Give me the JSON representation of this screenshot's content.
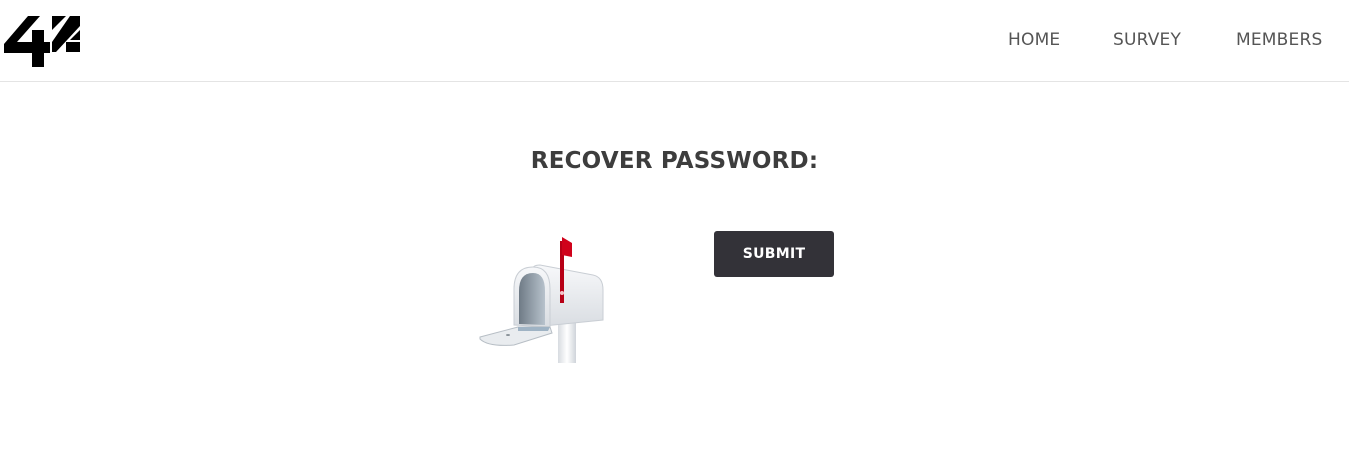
{
  "header": {
    "logo_icon": "42-logo-icon",
    "nav": {
      "home": "HOME",
      "survey": "SURVEY",
      "members": "MEMBERS"
    }
  },
  "main": {
    "title": "RECOVER PASSWORD:",
    "illustration_icon": "mailbox-icon",
    "submit_label": "SUBMIT"
  },
  "colors": {
    "button_bg": "#333238",
    "text_dark": "#3d3d3d",
    "nav_text": "#555555",
    "mailbox_flag": "#d0021b"
  }
}
